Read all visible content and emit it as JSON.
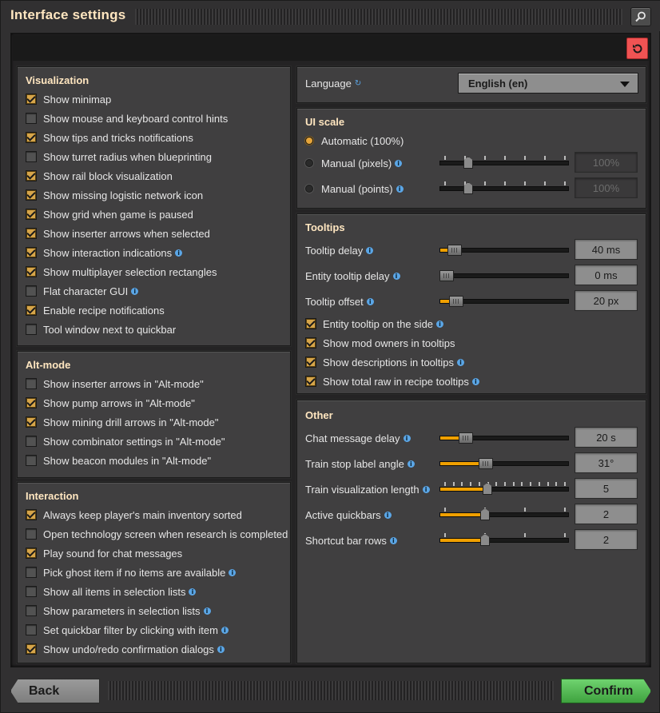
{
  "window": {
    "title": "Interface settings"
  },
  "visualization": {
    "header": "Visualization",
    "items": [
      {
        "label": "Show minimap",
        "checked": true,
        "info": false
      },
      {
        "label": "Show mouse and keyboard control hints",
        "checked": false,
        "info": false
      },
      {
        "label": "Show tips and tricks notifications",
        "checked": true,
        "info": false
      },
      {
        "label": "Show turret radius when blueprinting",
        "checked": false,
        "info": false
      },
      {
        "label": "Show rail block visualization",
        "checked": true,
        "info": false
      },
      {
        "label": "Show missing logistic network icon",
        "checked": true,
        "info": false
      },
      {
        "label": "Show grid when game is paused",
        "checked": true,
        "info": false
      },
      {
        "label": "Show inserter arrows when selected",
        "checked": true,
        "info": false
      },
      {
        "label": "Show interaction indications",
        "checked": true,
        "info": true
      },
      {
        "label": "Show multiplayer selection rectangles",
        "checked": true,
        "info": false
      },
      {
        "label": "Flat character GUI",
        "checked": false,
        "info": true
      },
      {
        "label": "Enable recipe notifications",
        "checked": true,
        "info": false
      },
      {
        "label": "Tool window next to quickbar",
        "checked": false,
        "info": false
      }
    ]
  },
  "altmode": {
    "header": "Alt-mode",
    "items": [
      {
        "label": "Show inserter arrows in \"Alt-mode\"",
        "checked": false,
        "info": false
      },
      {
        "label": "Show pump arrows in \"Alt-mode\"",
        "checked": true,
        "info": false
      },
      {
        "label": "Show mining drill arrows in \"Alt-mode\"",
        "checked": true,
        "info": false
      },
      {
        "label": "Show combinator settings in \"Alt-mode\"",
        "checked": false,
        "info": false
      },
      {
        "label": "Show beacon modules in \"Alt-mode\"",
        "checked": false,
        "info": false
      }
    ]
  },
  "interaction": {
    "header": "Interaction",
    "items": [
      {
        "label": "Always keep player's main inventory sorted",
        "checked": true,
        "info": false
      },
      {
        "label": "Open technology screen when research is completed",
        "checked": false,
        "info": false
      },
      {
        "label": "Play sound for chat messages",
        "checked": true,
        "info": false
      },
      {
        "label": "Pick ghost item if no items are available",
        "checked": false,
        "info": true
      },
      {
        "label": "Show all items in selection lists",
        "checked": false,
        "info": true
      },
      {
        "label": "Show parameters in selection lists",
        "checked": false,
        "info": true
      },
      {
        "label": "Set quickbar filter by clicking with item",
        "checked": false,
        "info": true
      },
      {
        "label": "Show undo/redo confirmation dialogs",
        "checked": true,
        "info": true
      }
    ]
  },
  "language": {
    "label": "Language",
    "value": "English (en)"
  },
  "uiscale": {
    "header": "UI scale",
    "automatic": "Automatic (100%)",
    "pixels": {
      "label": "Manual (pixels)",
      "value": "100%",
      "level": 0.2
    },
    "points": {
      "label": "Manual (points)",
      "value": "100%",
      "level": 0.2
    },
    "selected": "automatic"
  },
  "tooltips": {
    "header": "Tooltips",
    "delay": {
      "label": "Tooltip delay",
      "value": "40 ms",
      "level": 0.07
    },
    "entity_delay": {
      "label": "Entity tooltip delay",
      "value": "0 ms",
      "level": 0.0
    },
    "offset": {
      "label": "Tooltip offset",
      "value": "20 px",
      "level": 0.08
    },
    "checks": [
      {
        "label": "Entity tooltip on the side",
        "checked": true,
        "info": true
      },
      {
        "label": "Show mod owners in tooltips",
        "checked": true,
        "info": false
      },
      {
        "label": "Show descriptions in tooltips",
        "checked": true,
        "info": true
      },
      {
        "label": "Show total raw in recipe tooltips",
        "checked": true,
        "info": true
      }
    ]
  },
  "other": {
    "header": "Other",
    "chat_delay": {
      "label": "Chat message delay",
      "value": "20 s",
      "level": 0.17
    },
    "train_angle": {
      "label": "Train stop label angle",
      "value": "31°",
      "level": 0.34
    },
    "train_length": {
      "label": "Train visualization length",
      "value": "5",
      "level": 0.36
    },
    "quickbars": {
      "label": "Active quickbars",
      "value": "2",
      "level": 0.34
    },
    "shortcut_rows": {
      "label": "Shortcut bar rows",
      "value": "2",
      "level": 0.34
    }
  },
  "footer": {
    "back": "Back",
    "confirm": "Confirm"
  },
  "colors": {
    "accent": "#f0a000",
    "header": "#ffe6c0",
    "confirm": "#5ec35e",
    "reset": "#f05353"
  }
}
